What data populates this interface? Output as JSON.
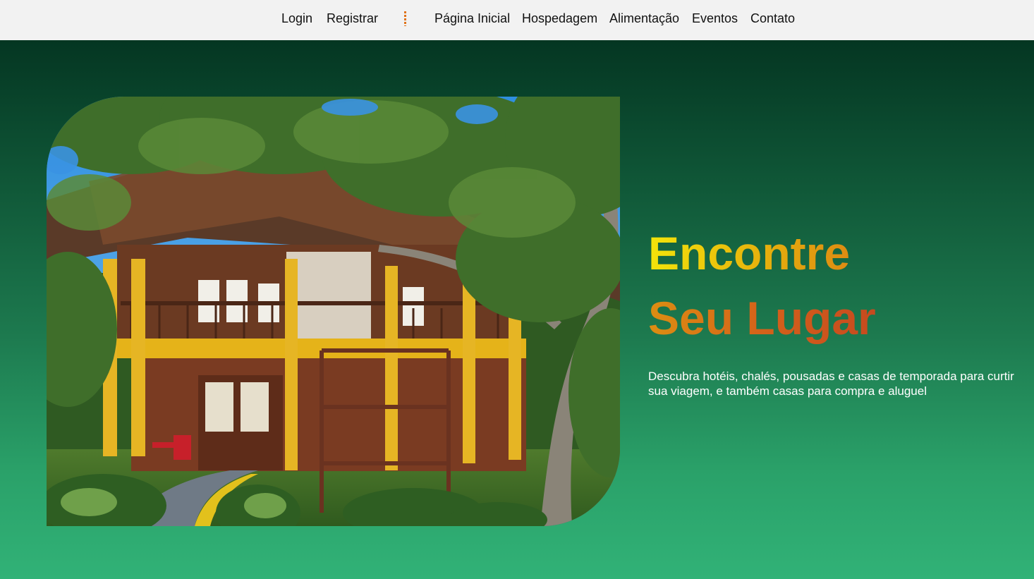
{
  "nav": {
    "auth": [
      {
        "label": "Login"
      },
      {
        "label": "Registrar"
      }
    ],
    "main": [
      {
        "label": "Página Inicial"
      },
      {
        "label": "Hospedagem"
      },
      {
        "label": "Alimentação"
      },
      {
        "label": "Eventos"
      },
      {
        "label": "Contato"
      }
    ]
  },
  "hero": {
    "headline_line1": "Encontre",
    "headline_line2": "Seu Lugar",
    "description": "Descubra hotéis, chalés, pousadas e casas de temporada para curtir sua viagem, e também casas para compra e aluguel"
  },
  "colors": {
    "accent_divider": "#e0731a",
    "hero_gradient_top": "#043622",
    "hero_gradient_bottom": "#31b277",
    "headline_yellow": "#f3e40b",
    "headline_orange": "#c64a1f"
  }
}
